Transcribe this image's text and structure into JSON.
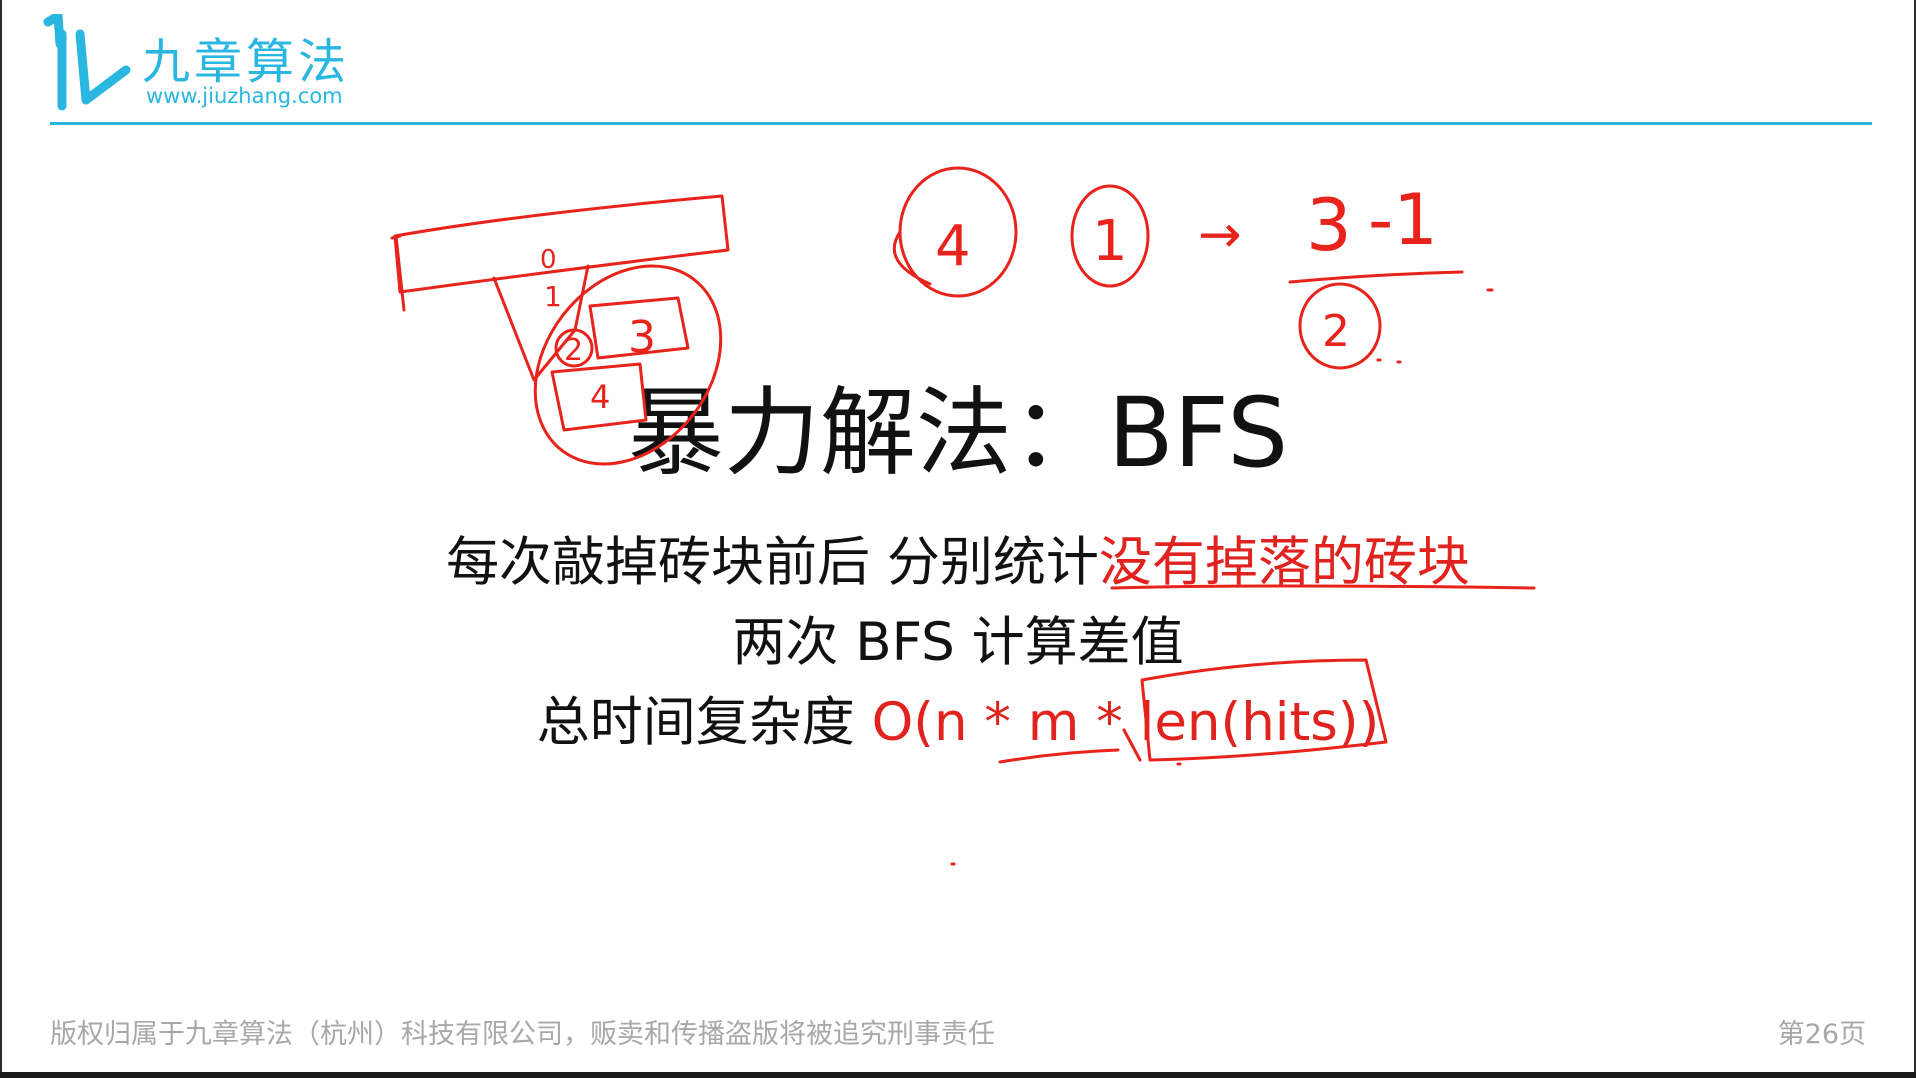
{
  "logo": {
    "title": "九章算法",
    "url": "www.jiuzhang.com",
    "color": "#29b6e0"
  },
  "slide": {
    "title": "暴力解法：BFS",
    "line1_prefix": "每次敲掉砖块前后 分别统计",
    "line1_highlight": "没有掉落的砖块",
    "line2": "两次 BFS 计算差值",
    "line3_prefix": "总时间复杂度 ",
    "line3_highlight": "O(n * m * len(hits))"
  },
  "annotations": {
    "pen_color": "#e8231c",
    "grid_labels": [
      "0",
      "1",
      "2",
      "3",
      "4"
    ],
    "sequence": [
      "4",
      "1",
      "→",
      "3",
      "-1",
      "2"
    ]
  },
  "footer": {
    "copyright": "版权归属于九章算法（杭州）科技有限公司，贩卖和传播盗版将被追究刑事责任",
    "page": "第26页"
  }
}
